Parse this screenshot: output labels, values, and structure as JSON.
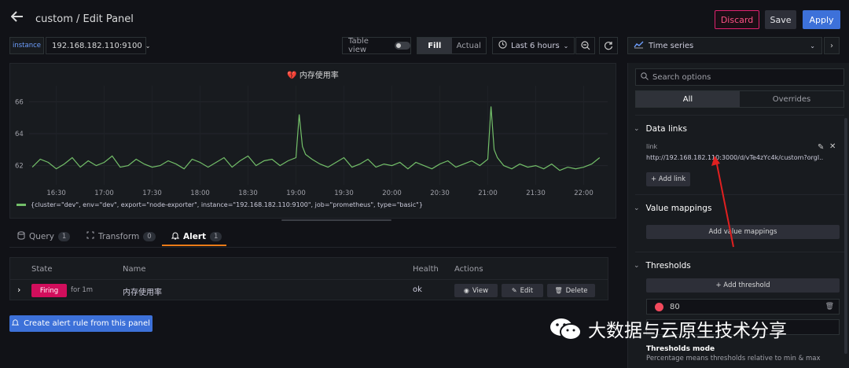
{
  "header": {
    "title": "custom / Edit Panel",
    "discard_label": "Discard",
    "save_label": "Save",
    "apply_label": "Apply"
  },
  "toolbar": {
    "variable_label": "instance",
    "variable_value": "192.168.182.110:9100",
    "table_view_label": "Table view",
    "fill_label": "Fill",
    "actual_label": "Actual",
    "time_range": "Last 6 hours",
    "visualization": "Time series"
  },
  "panel": {
    "title": "内存使用率",
    "legend": "{cluster=\"dev\", env=\"dev\", export=\"node-exporter\", instance=\"192.168.182.110:9100\", job=\"prometheus\", type=\"basic\"}",
    "series_color": "#73bf69"
  },
  "chart_data": {
    "type": "line",
    "title": "内存使用率",
    "x": [
      "16:30",
      "17:00",
      "17:30",
      "18:00",
      "18:30",
      "19:00",
      "19:30",
      "20:00",
      "20:30",
      "21:00",
      "21:30",
      "22:00"
    ],
    "y_ticks": [
      "66",
      "64",
      "62"
    ],
    "ylim": [
      60.8,
      67
    ],
    "series": [
      {
        "name": "{cluster=\"dev\", env=\"dev\", export=\"node-exporter\", instance=\"192.168.182.110:9100\", job=\"prometheus\", type=\"basic\"}",
        "times": [
          "16:15",
          "16:20",
          "16:25",
          "16:30",
          "16:35",
          "16:40",
          "16:45",
          "16:50",
          "16:55",
          "17:00",
          "17:05",
          "17:10",
          "17:15",
          "17:20",
          "17:25",
          "17:30",
          "17:35",
          "17:40",
          "17:45",
          "17:50",
          "17:55",
          "18:00",
          "18:05",
          "18:10",
          "18:15",
          "18:20",
          "18:25",
          "18:30",
          "18:35",
          "18:40",
          "18:45",
          "18:50",
          "18:55",
          "19:00",
          "19:02",
          "19:04",
          "19:06",
          "19:10",
          "19:15",
          "19:20",
          "19:25",
          "19:30",
          "19:35",
          "19:40",
          "19:45",
          "19:50",
          "19:55",
          "20:00",
          "20:05",
          "20:10",
          "20:15",
          "20:20",
          "20:25",
          "20:30",
          "20:35",
          "20:40",
          "20:45",
          "20:50",
          "20:55",
          "21:00",
          "21:02",
          "21:04",
          "21:06",
          "21:10",
          "21:15",
          "21:20",
          "21:25",
          "21:30",
          "21:35",
          "21:40",
          "21:45",
          "21:50",
          "21:55",
          "22:00",
          "22:05",
          "22:10"
        ],
        "values": [
          61.9,
          62.4,
          62.2,
          61.8,
          62.1,
          62.5,
          61.9,
          62.3,
          62.0,
          62.2,
          62.6,
          61.9,
          62.0,
          62.4,
          62.1,
          61.9,
          62.0,
          62.3,
          62.1,
          61.8,
          62.4,
          62.2,
          61.9,
          62.2,
          62.5,
          61.9,
          62.3,
          62.6,
          62.0,
          62.3,
          62.4,
          62.0,
          62.3,
          62.5,
          65.2,
          63.2,
          62.7,
          62.4,
          62.1,
          61.9,
          62.2,
          62.5,
          61.9,
          62.1,
          62.4,
          61.9,
          62.1,
          62.0,
          62.2,
          61.8,
          62.2,
          62.0,
          61.8,
          62.1,
          62.3,
          61.9,
          62.1,
          62.3,
          62.0,
          62.4,
          65.7,
          63.0,
          62.5,
          62.0,
          61.8,
          62.1,
          61.9,
          62.0,
          61.8,
          62.1,
          61.7,
          61.9,
          61.8,
          61.9,
          62.1,
          62.5
        ]
      }
    ]
  },
  "editor_tabs": [
    {
      "label": "Query",
      "count": "1"
    },
    {
      "label": "Transform",
      "count": "0"
    },
    {
      "label": "Alert",
      "count": "1"
    }
  ],
  "alerts_table": {
    "headers": [
      "State",
      "Name",
      "Health",
      "Actions"
    ],
    "row": {
      "state": "Firing",
      "for": "for 1m",
      "name": "内存使用率",
      "health": "ok",
      "view": "View",
      "edit": "Edit",
      "delete": "Delete"
    }
  },
  "create_alert_label": "Create alert rule from this panel",
  "options": {
    "search_placeholder": "Search options",
    "all_label": "All",
    "overrides_label": "Overrides",
    "data_links_title": "Data links",
    "link_label": "link",
    "link_url": "http://192.168.182.110:3000/d/vTe4zYc4k/custom?orgI...",
    "add_link_label": "+ Add link",
    "value_mappings_title": "Value mappings",
    "add_value_mappings_label": "Add value mappings",
    "thresholds_title": "Thresholds",
    "add_threshold_label": "+ Add threshold",
    "threshold_value": "80",
    "threshold_color": "#f2495c",
    "thresholds_mode_title": "Thresholds mode",
    "thresholds_mode_desc": "Percentage means thresholds relative to min & max"
  },
  "watermark": {
    "text": "大数据与云原生技术分享"
  }
}
